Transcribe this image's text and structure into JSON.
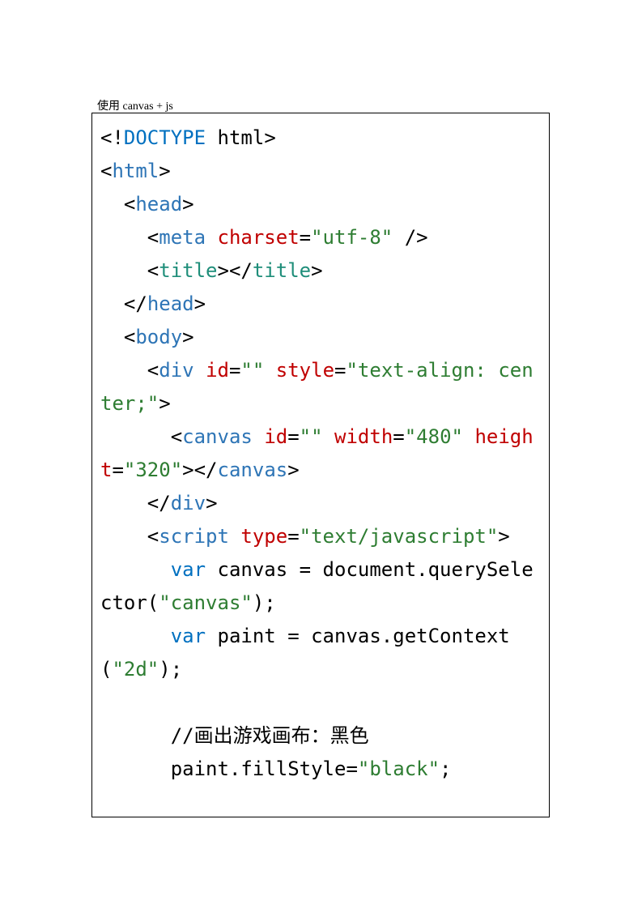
{
  "caption": "使用 canvas + js",
  "code": {
    "l1": {
      "a": "<!",
      "b": "DOCTYPE",
      "c": " html",
      "d": ">"
    },
    "l2": {
      "a": "<",
      "b": "html",
      "c": ">"
    },
    "l3": {
      "sp": "  ",
      "a": "<",
      "b": "head",
      "c": ">"
    },
    "l4": {
      "sp": "    ",
      "a": "<",
      "b": "meta",
      "c": " ",
      "d": "charset",
      "e": "=",
      "f": "\"utf-8\"",
      "g": " />"
    },
    "l5": {
      "sp": "    ",
      "a": "<",
      "b": "title",
      "c": "></",
      "d": "title",
      "e": ">"
    },
    "l6": {
      "sp": "  ",
      "a": "</",
      "b": "head",
      "c": ">"
    },
    "l7": {
      "sp": "  ",
      "a": "<",
      "b": "body",
      "c": ">"
    },
    "l8": {
      "sp": "    ",
      "a": "<",
      "b": "div",
      "c": " ",
      "d": "id",
      "e": "=",
      "f": "\"\"",
      "g": " ",
      "h": "style",
      "i": "=",
      "j": "\"text-align: center;\"",
      "k": ">"
    },
    "l9": {
      "sp": "      ",
      "a": "<",
      "b": "canvas",
      "c": " ",
      "d": "id",
      "e": "=",
      "f": "\"\"",
      "g": " ",
      "h": "width",
      "i": "=",
      "j": "\"480\"",
      "k": " ",
      "l": "height",
      "m": "=",
      "n": "\"320\"",
      "o": "></",
      "p": "canvas",
      "q": ">"
    },
    "l10": {
      "sp": "    ",
      "a": "</",
      "b": "div",
      "c": ">"
    },
    "l11": {
      "sp": "    ",
      "a": "<",
      "b": "script",
      "c": " ",
      "d": "type",
      "e": "=",
      "f": "\"text/javascript\"",
      "g": ">"
    },
    "l12": {
      "sp": "      ",
      "a": "var",
      "b": " canvas = document.querySelector(",
      "c": "\"canvas\"",
      "d": ");"
    },
    "l13": {
      "sp": "      ",
      "a": "var",
      "b": " paint = canvas.getContext(",
      "c": "\"2d\"",
      "d": ");"
    },
    "blank": "",
    "l14": {
      "sp": "      ",
      "a": "//画出游戏画布：黑色"
    },
    "l15": {
      "sp": "      ",
      "a": "paint.fillStyle=",
      "b": "\"black\"",
      "c": ";"
    }
  }
}
